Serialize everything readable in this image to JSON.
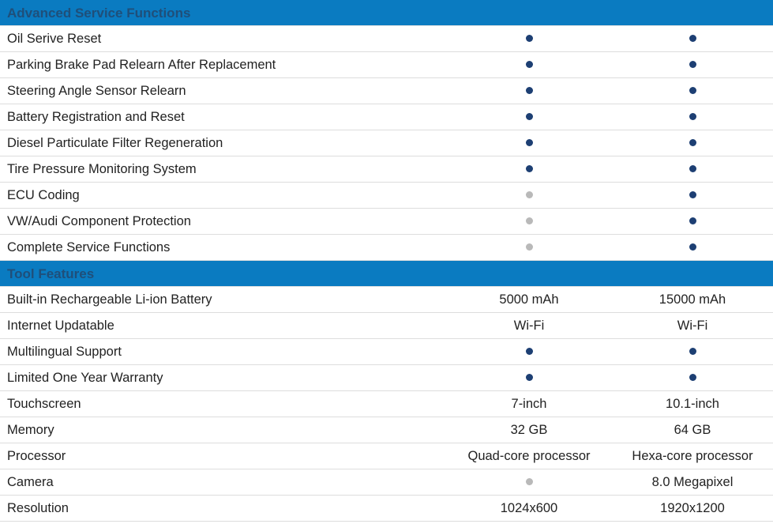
{
  "colors": {
    "header_bg": "#0a7bc1",
    "header_text": "#1f4f7a",
    "dot_full": "#1d3f73",
    "dot_empty": "#b9b9b9"
  },
  "sections": [
    {
      "title": "Advanced Service Functions",
      "rows": [
        {
          "label": "Oil Serive Reset",
          "a": {
            "type": "dot",
            "status": "full"
          },
          "b": {
            "type": "dot",
            "status": "full"
          }
        },
        {
          "label": "Parking Brake Pad Relearn After Replacement",
          "a": {
            "type": "dot",
            "status": "full"
          },
          "b": {
            "type": "dot",
            "status": "full"
          }
        },
        {
          "label": "Steering Angle Sensor Relearn",
          "a": {
            "type": "dot",
            "status": "full"
          },
          "b": {
            "type": "dot",
            "status": "full"
          }
        },
        {
          "label": "Battery Registration and Reset",
          "a": {
            "type": "dot",
            "status": "full"
          },
          "b": {
            "type": "dot",
            "status": "full"
          }
        },
        {
          "label": "Diesel Particulate Filter Regeneration",
          "a": {
            "type": "dot",
            "status": "full"
          },
          "b": {
            "type": "dot",
            "status": "full"
          }
        },
        {
          "label": "Tire Pressure Monitoring System",
          "a": {
            "type": "dot",
            "status": "full"
          },
          "b": {
            "type": "dot",
            "status": "full"
          }
        },
        {
          "label": "ECU Coding",
          "a": {
            "type": "dot",
            "status": "empty"
          },
          "b": {
            "type": "dot",
            "status": "full"
          }
        },
        {
          "label": "VW/Audi Component Protection",
          "a": {
            "type": "dot",
            "status": "empty"
          },
          "b": {
            "type": "dot",
            "status": "full"
          }
        },
        {
          "label": "Complete Service Functions",
          "a": {
            "type": "dot",
            "status": "empty"
          },
          "b": {
            "type": "dot",
            "status": "full"
          }
        }
      ]
    },
    {
      "title": "Tool Features",
      "rows": [
        {
          "label": "Built-in Rechargeable Li-ion Battery",
          "a": {
            "type": "text",
            "value": "5000 mAh"
          },
          "b": {
            "type": "text",
            "value": "15000 mAh"
          }
        },
        {
          "label": "Internet Updatable",
          "a": {
            "type": "text",
            "value": "Wi-Fi"
          },
          "b": {
            "type": "text",
            "value": "Wi-Fi"
          }
        },
        {
          "label": "Multilingual Support",
          "a": {
            "type": "dot",
            "status": "full"
          },
          "b": {
            "type": "dot",
            "status": "full"
          }
        },
        {
          "label": "Limited One Year Warranty",
          "a": {
            "type": "dot",
            "status": "full"
          },
          "b": {
            "type": "dot",
            "status": "full"
          }
        },
        {
          "label": "Touchscreen",
          "a": {
            "type": "text",
            "value": "7-inch"
          },
          "b": {
            "type": "text",
            "value": "10.1-inch"
          }
        },
        {
          "label": "Memory",
          "a": {
            "type": "text",
            "value": "32 GB"
          },
          "b": {
            "type": "text",
            "value": "64 GB"
          }
        },
        {
          "label": "Processor",
          "a": {
            "type": "text",
            "value": "Quad-core processor"
          },
          "b": {
            "type": "text",
            "value": "Hexa-core processor"
          }
        },
        {
          "label": "Camera",
          "a": {
            "type": "dot",
            "status": "empty"
          },
          "b": {
            "type": "text",
            "value": "8.0 Megapixel"
          }
        },
        {
          "label": "Resolution",
          "a": {
            "type": "text",
            "value": "1024x600"
          },
          "b": {
            "type": "text",
            "value": "1920x1200"
          }
        }
      ]
    }
  ]
}
